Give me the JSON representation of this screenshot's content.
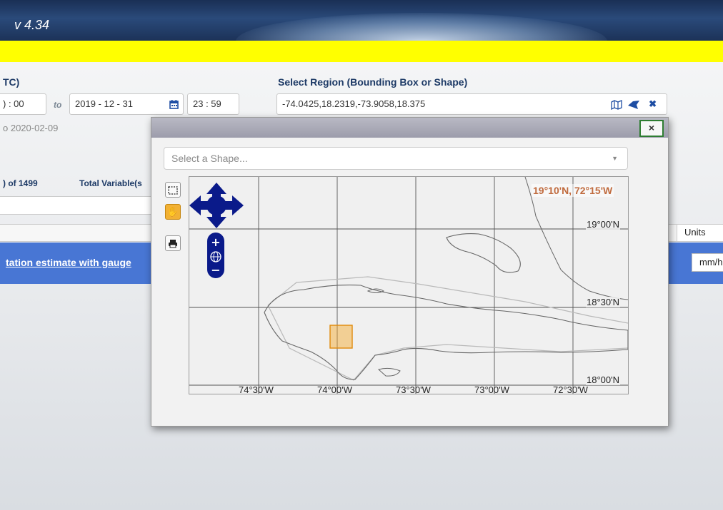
{
  "app": {
    "version": "v 4.34"
  },
  "date_range": {
    "label_fragment": "TC)",
    "start_time": ") : 00",
    "to_label": "to",
    "end_date": "2019  - 12  - 31",
    "end_time": "23 : 59",
    "availability_fragment": "o 2020-02-09"
  },
  "region": {
    "label": "Select Region (Bounding Box or Shape)",
    "value": "-74.0425,18.2319,-73.9058,18.375"
  },
  "results": {
    "count_fragment": ") of 1499",
    "total_variables_fragment": "Total Variable(s"
  },
  "table": {
    "units_header": "Units",
    "row_link_fragment": "tation estimate with gauge",
    "row_units_fragment": "mm/h"
  },
  "modal": {
    "close_label": "×",
    "shape_select_placeholder": "Select a Shape...",
    "tools": {
      "bbox": "bbox-icon",
      "pan": "hand-icon",
      "print": "print-icon"
    },
    "map": {
      "coordinate_readout": "19°10'N, 72°15'W",
      "lat_labels": [
        "19°00'N",
        "18°30'N",
        "18°00'N"
      ],
      "lon_labels": [
        "74°30'W",
        "74°00'W",
        "73°30'W",
        "73°00'W",
        "72°30'W"
      ],
      "selection_color": "#f5a623"
    }
  },
  "colors": {
    "banner": "#ffff00",
    "accent_row": "#4876d4",
    "header_label": "#1d3a66"
  }
}
